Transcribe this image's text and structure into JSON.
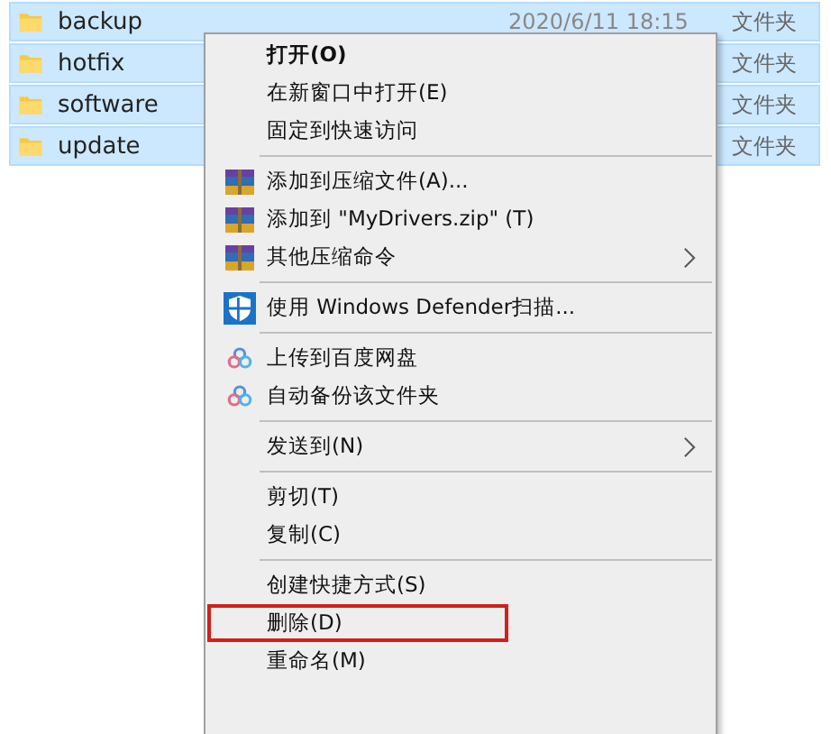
{
  "files": [
    {
      "name": "backup",
      "date": "2020/6/11 18:15",
      "type": "文件夹",
      "selected": true
    },
    {
      "name": "hotfix",
      "type": "文件夹",
      "selected": true
    },
    {
      "name": "software",
      "type": "文件夹",
      "selected": true
    },
    {
      "name": "update",
      "type": "文件夹",
      "selected": true
    }
  ],
  "context_menu": {
    "items": [
      {
        "kind": "item",
        "label": "打开(O)",
        "default": true
      },
      {
        "kind": "item",
        "label": "在新窗口中打开(E)"
      },
      {
        "kind": "item",
        "label": "固定到快速访问"
      },
      {
        "kind": "separator"
      },
      {
        "kind": "archive",
        "label": "添加到压缩文件(A)..."
      },
      {
        "kind": "archive",
        "label": "添加到 \"MyDrivers.zip\" (T)"
      },
      {
        "kind": "archive",
        "label": "其他压缩命令",
        "submenu": true
      },
      {
        "kind": "separator"
      },
      {
        "kind": "shield",
        "label": "使用 Windows Defender扫描..."
      },
      {
        "kind": "separator"
      },
      {
        "kind": "cloud",
        "label": "上传到百度网盘"
      },
      {
        "kind": "cloud",
        "label": "自动备份该文件夹"
      },
      {
        "kind": "separator"
      },
      {
        "kind": "item",
        "label": "发送到(N)",
        "submenu": true
      },
      {
        "kind": "separator"
      },
      {
        "kind": "item",
        "label": "剪切(T)"
      },
      {
        "kind": "item",
        "label": "复制(C)"
      },
      {
        "kind": "separator"
      },
      {
        "kind": "item",
        "label": "创建快捷方式(S)"
      },
      {
        "kind": "item",
        "label": "删除(D)",
        "highlighted": true
      },
      {
        "kind": "item",
        "label": "重命名(M)"
      }
    ]
  }
}
